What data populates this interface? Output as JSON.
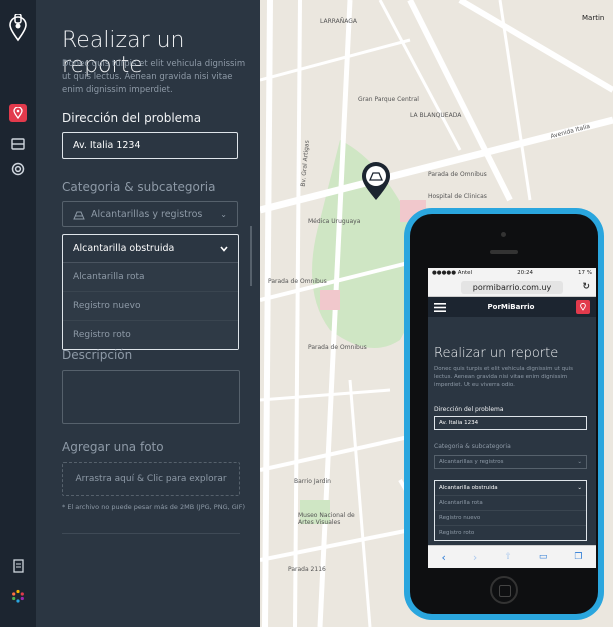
{
  "form": {
    "title": "Realizar un reporte",
    "description": "Donec quis turpis et elit vehicula dignissim ut quis lectus. Aenean gravida nisi vitae enim dignissim imperdiet.",
    "address_label": "Dirección del problema",
    "address_value": "Av. Italia 1234",
    "category_label": "Categoria & subcategoria",
    "category_value": "Alcantarillas y registros",
    "subcategory_selected": "Alcantarilla obstruida",
    "subcategory_options": [
      "Alcantarilla rota",
      "Registro nuevo",
      "Registro roto"
    ],
    "description_label": "Descripción",
    "photo_label": "Agregar una foto",
    "dropzone_text": "Arrastra aquí & Clic para explorar",
    "photo_note": "* El archivo no puede pesar más de 2MB (JPG, PNG, GIF)"
  },
  "map_labels": [
    "LARRAÑAGA",
    "Gran Parque Central",
    "LA BLANQUEADA",
    "Parada de Omnibus",
    "Hospital de Clinicas",
    "Médica Uruguaya",
    "Parada de Omnibus",
    "Parada de Omnibus",
    "Barrio Jardin",
    "Museo Nacional de Artes Visuales",
    "Parada 2116",
    "Avenida Italia",
    "Bv. Gral Artigas",
    "Martin"
  ],
  "phone": {
    "carrier": "●●●●● Antel",
    "time": "20:24",
    "battery": "17 %",
    "url": "pormibarrio.com.uy",
    "brand": "PorMiBarrio",
    "title": "Realizar un reporte",
    "description": "Donec quis turpis et elit vehicula dignissim ut quis lectus. Aenean gravida nisi vitae enim dignissim imperdiet. Ut eu viverra odio.",
    "address_label": "Dirección del problema",
    "address_value": "Av. Italia 1234",
    "category_label": "Categoria & subcategoria",
    "category_value": "Alcantarillas y registros",
    "subcategory_selected": "Alcantarilla obstruida",
    "options": [
      "Alcantarilla rota",
      "Registro nuevo",
      "Registro roto"
    ]
  },
  "colors": {
    "accent": "#e23a4c",
    "panel": "#2b3642",
    "rail": "#1c2530",
    "phone": "#2aa6de"
  }
}
